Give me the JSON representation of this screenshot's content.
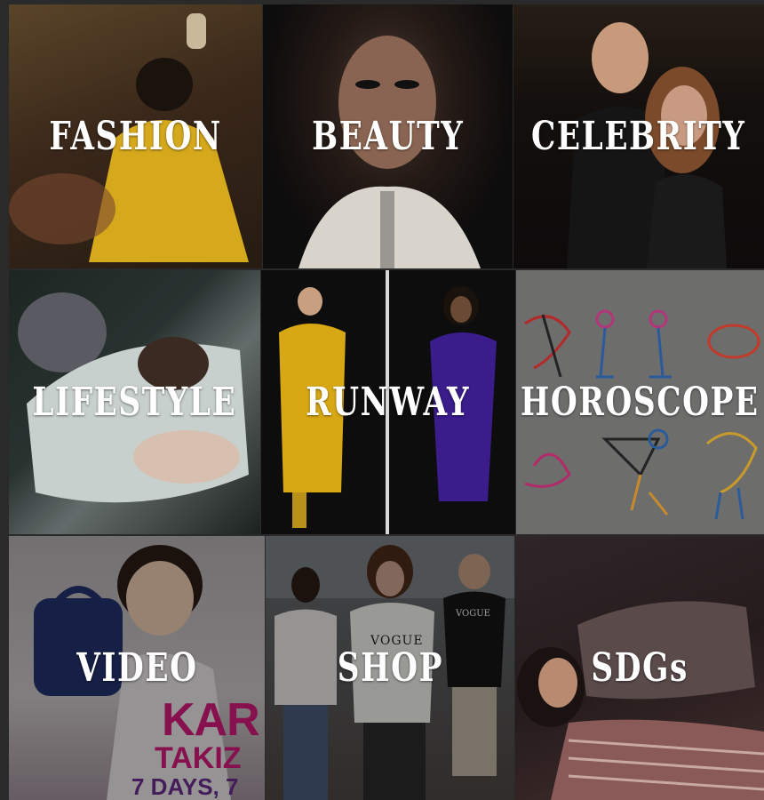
{
  "categories": [
    {
      "id": "fashion",
      "label": "FASHION"
    },
    {
      "id": "beauty",
      "label": "BEAUTY"
    },
    {
      "id": "celebrity",
      "label": "CELEBRITY"
    },
    {
      "id": "lifestyle",
      "label": "LIFESTYLE"
    },
    {
      "id": "runway",
      "label": "RUNWAY"
    },
    {
      "id": "horoscope",
      "label": "HOROSCOPE"
    },
    {
      "id": "video",
      "label": "VIDEO"
    },
    {
      "id": "shop",
      "label": "SHOP"
    },
    {
      "id": "sdgs",
      "label": "SDGs"
    }
  ],
  "tile_images": {
    "video_magazine_cover_big": "KAR",
    "video_magazine_cover_name": "TAKIZ",
    "video_magazine_cover_tagline": "7 DAYS, 7",
    "shop_sweatshirt_print": "VOGUE",
    "shop_black_shirt_print": "VOGUE"
  },
  "colors": {
    "label_text": "#ffffff",
    "overlay": "rgba(0,0,0,0.35)",
    "magazine_pink": "#d01a78",
    "magazine_purple": "#6b2c8a"
  }
}
